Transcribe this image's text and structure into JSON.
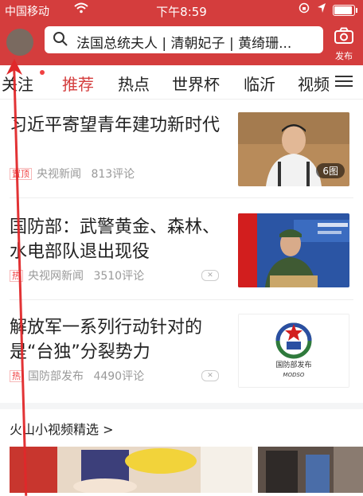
{
  "status_bar": {
    "carrier": "中国移动",
    "time": "下午8:59",
    "battery_level": 0.85
  },
  "header": {
    "search_text": "法国总统夫人 | 清朝妃子 | 黄绮珊...",
    "publish_label": "发布"
  },
  "tabs": [
    "关注",
    "推荐",
    "热点",
    "世界杯",
    "临沂",
    "视频"
  ],
  "active_tab": "推荐",
  "articles": [
    {
      "title": "习近平寄望青年建功新时代",
      "badge": "置顶",
      "source": "央视新闻",
      "comments": "813评论",
      "image_count": "6图"
    },
    {
      "title": "国防部：武警黄金、森林、水电部队退出现役",
      "badge": "热",
      "source": "央视网新闻",
      "comments": "3510评论"
    },
    {
      "title": "解放军一系列行动针对的是“台独”分裂势力",
      "badge": "热",
      "source": "国防部发布",
      "comments": "4490评论",
      "logo_text": "国防部发布",
      "logo_sub": "MODSO"
    }
  ],
  "video_section": {
    "title": "火山小视频精选 >"
  },
  "colors": {
    "brand_red": "#d43d3d",
    "badge_red": "#f04142",
    "arrow_red": "#e0282a"
  },
  "icons": [
    "wifi-icon",
    "location-icon",
    "lock-rotation-icon",
    "battery-icon",
    "search-icon",
    "camera-icon",
    "menu-icon",
    "dislike-icon"
  ]
}
